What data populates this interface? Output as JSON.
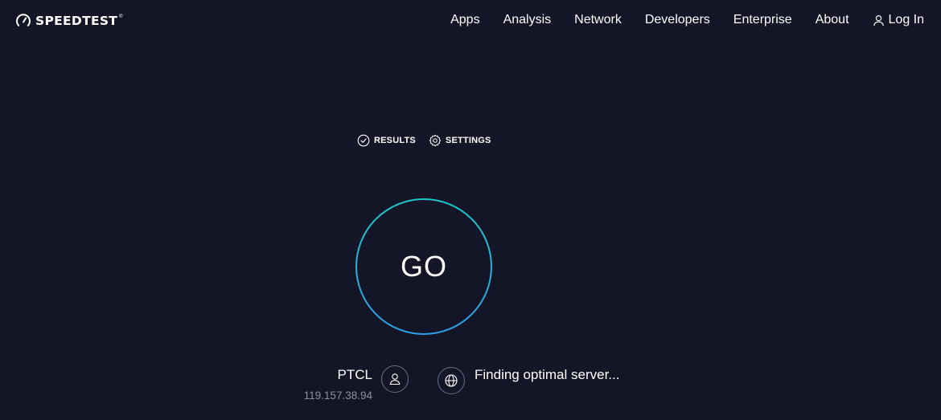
{
  "brand": {
    "name": "SPEEDTEST",
    "tm": "®",
    "icon": "speedometer-icon"
  },
  "nav": {
    "items": [
      {
        "label": "Apps"
      },
      {
        "label": "Analysis"
      },
      {
        "label": "Network"
      },
      {
        "label": "Developers"
      },
      {
        "label": "Enterprise"
      },
      {
        "label": "About"
      }
    ],
    "login": {
      "label": "Log In",
      "icon": "user-icon"
    }
  },
  "test_nav": {
    "results": {
      "label": "RESULTS",
      "icon": "check-circle-icon"
    },
    "settings": {
      "label": "SETTINGS",
      "icon": "gear-icon"
    }
  },
  "go_button": {
    "label": "GO"
  },
  "isp": {
    "name": "PTCL",
    "ip": "119.157.38.94",
    "icon": "user-icon"
  },
  "server": {
    "status": "Finding optimal server...",
    "icon": "globe-icon"
  },
  "colors": {
    "background": "#141526",
    "ring_start": "#1ec6c6",
    "ring_end": "#2e9ee8",
    "muted_text": "#8d8fa3",
    "icon_border": "#6d6f84"
  }
}
